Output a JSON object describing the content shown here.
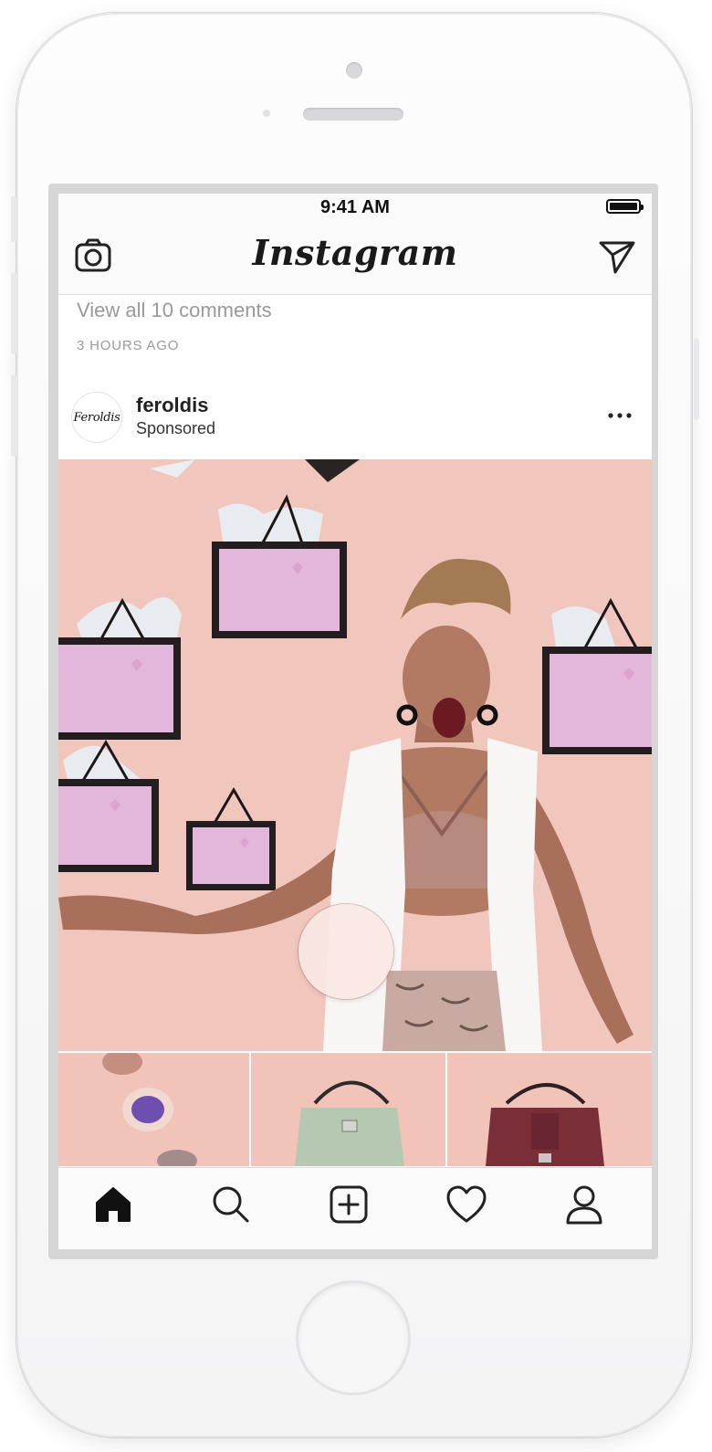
{
  "status_bar": {
    "time": "9:41 AM",
    "battery_icon": "battery-full-icon"
  },
  "nav": {
    "logo": "Instagram",
    "camera_icon": "camera-icon",
    "direct_icon": "paper-plane-icon"
  },
  "feed": {
    "comments_link": "View all 10 comments",
    "timestamp": "3 HOURS AGO"
  },
  "post": {
    "username": "feroldis",
    "label": "Sponsored",
    "avatar_logo_text": "Feroldis",
    "more_icon": "more-dots-icon"
  },
  "tab_bar": {
    "items": [
      {
        "icon": "home-icon",
        "active": true
      },
      {
        "icon": "search-icon",
        "active": false
      },
      {
        "icon": "add-post-icon",
        "active": false
      },
      {
        "icon": "heart-icon",
        "active": false
      },
      {
        "icon": "profile-icon",
        "active": false
      }
    ]
  },
  "colors": {
    "media_background": "#f1c6bc",
    "bag_pink": "#e6b8dc",
    "text_secondary": "#999999"
  }
}
